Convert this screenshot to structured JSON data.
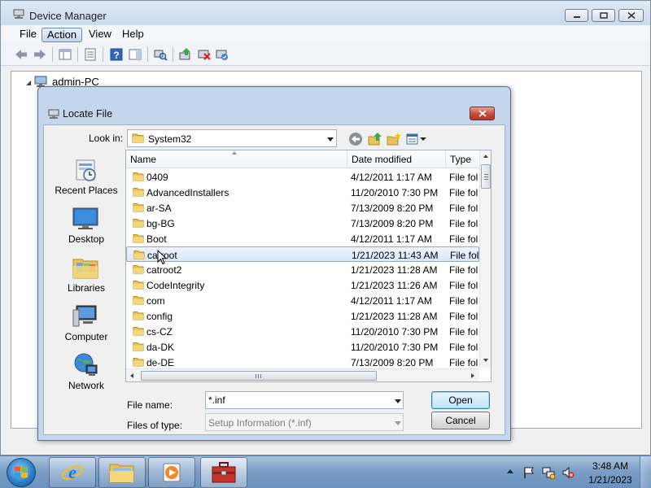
{
  "device_manager": {
    "title": "Device Manager",
    "menu": [
      "File",
      "Action",
      "View",
      "Help"
    ],
    "active_menu": "Action",
    "tree_root": "admin-PC"
  },
  "dialog": {
    "title": "Locate File",
    "look_in_label": "Look in:",
    "look_in_value": "System32",
    "places": [
      "Recent Places",
      "Desktop",
      "Libraries",
      "Computer",
      "Network"
    ],
    "columns": [
      "Name",
      "Date modified",
      "Type"
    ],
    "rows": [
      {
        "name": "0409",
        "date": "4/12/2011 1:17 AM",
        "type": "File fol"
      },
      {
        "name": "AdvancedInstallers",
        "date": "11/20/2010 7:30 PM",
        "type": "File fol"
      },
      {
        "name": "ar-SA",
        "date": "7/13/2009 8:20 PM",
        "type": "File fol"
      },
      {
        "name": "bg-BG",
        "date": "7/13/2009 8:20 PM",
        "type": "File fol"
      },
      {
        "name": "Boot",
        "date": "4/12/2011 1:17 AM",
        "type": "File fol"
      },
      {
        "name": "catroot",
        "date": "1/21/2023 11:43 AM",
        "type": "File fol"
      },
      {
        "name": "catroot2",
        "date": "1/21/2023 11:28 AM",
        "type": "File fol"
      },
      {
        "name": "CodeIntegrity",
        "date": "1/21/2023 11:26 AM",
        "type": "File fol"
      },
      {
        "name": "com",
        "date": "4/12/2011 1:17 AM",
        "type": "File fol"
      },
      {
        "name": "config",
        "date": "1/21/2023 11:28 AM",
        "type": "File fol"
      },
      {
        "name": "cs-CZ",
        "date": "11/20/2010 7:30 PM",
        "type": "File fol"
      },
      {
        "name": "da-DK",
        "date": "11/20/2010 7:30 PM",
        "type": "File fol"
      },
      {
        "name": "de-DE",
        "date": "7/13/2009 8:20 PM",
        "type": "File fol"
      }
    ],
    "selected_row": 5,
    "file_name_label": "File name:",
    "file_name_value": "*.inf",
    "file_type_label": "Files of type:",
    "file_type_value": "Setup Information (*.inf)",
    "open_label": "Open",
    "cancel_label": "Cancel"
  },
  "taskbar": {
    "time": "3:48 AM",
    "date": "1/21/2023"
  }
}
